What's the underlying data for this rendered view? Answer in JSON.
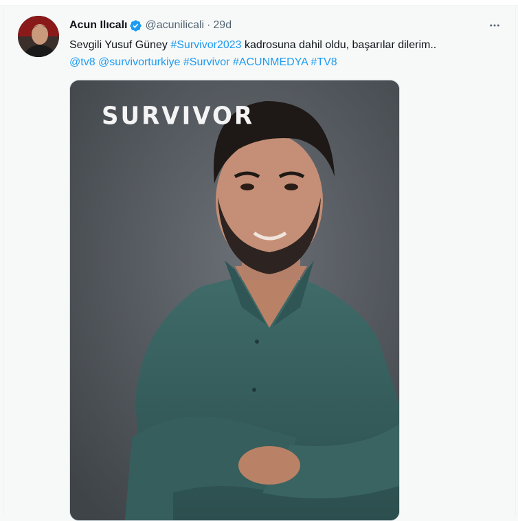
{
  "tweet": {
    "author": {
      "display_name": "Acun Ilıcalı",
      "handle": "@acunilicali",
      "verified": true,
      "verified_icon": "verified-badge-icon",
      "avatar_icon": "avatar"
    },
    "separator": "·",
    "time": "29d",
    "more_icon": "more-horizontal-icon",
    "text": {
      "segments_line1": [
        {
          "type": "text",
          "value": "Sevgili Yusuf Güney "
        },
        {
          "type": "hashtag",
          "value": "#Survivor2023"
        },
        {
          "type": "text",
          "value": " kadrosuna dahil oldu, başarılar dilerim.."
        }
      ],
      "segments_line2": [
        {
          "type": "mention",
          "value": "@tv8"
        },
        {
          "type": "text",
          "value": " "
        },
        {
          "type": "mention",
          "value": "@survivorturkiye"
        },
        {
          "type": "text",
          "value": " "
        },
        {
          "type": "hashtag",
          "value": "#Survivor"
        },
        {
          "type": "text",
          "value": " "
        },
        {
          "type": "hashtag",
          "value": "#ACUNMEDYA"
        },
        {
          "type": "text",
          "value": " "
        },
        {
          "type": "hashtag",
          "value": "#TV8"
        }
      ]
    },
    "media": {
      "logo_text": "SURVIVOR"
    }
  },
  "colors": {
    "link": "#1d9bf0",
    "text": "#0f1419",
    "secondary": "#536471",
    "verified": "#1d9bf0"
  }
}
